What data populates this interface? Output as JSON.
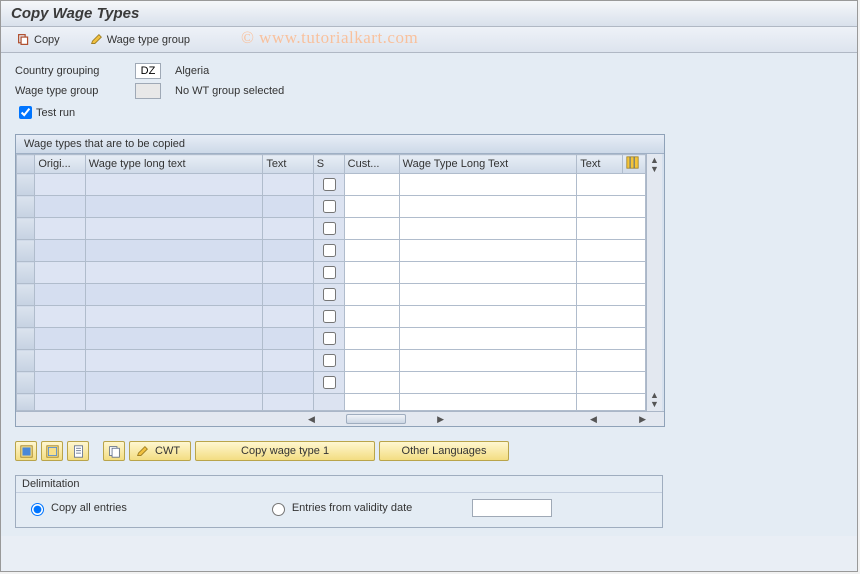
{
  "title": "Copy Wage Types",
  "toolbar": {
    "copy": "Copy",
    "wage_type_group": "Wage type group"
  },
  "watermark": "©  www.tutorialkart.com",
  "form": {
    "country_grouping_label": "Country grouping",
    "country_grouping_value": "DZ",
    "country_grouping_text": "Algeria",
    "wage_type_group_label": "Wage type group",
    "wage_type_group_value": "",
    "wage_type_group_text": "No WT group selected",
    "test_run_label": "Test run"
  },
  "grid": {
    "title": "Wage types that are to be copied",
    "columns": {
      "origi": "Origi...",
      "long_text_l": "Wage type long text",
      "text_l": "Text",
      "s": "S",
      "cust": "Cust...",
      "long_text_r": "Wage Type Long Text",
      "text_r": "Text"
    }
  },
  "buttons": {
    "cwt": "CWT",
    "copy_wage_type": "Copy wage type 1",
    "other_languages": "Other Languages"
  },
  "delimitation": {
    "title": "Delimitation",
    "copy_all": "Copy all entries",
    "entries_from": "Entries from validity date",
    "date_value": ""
  }
}
